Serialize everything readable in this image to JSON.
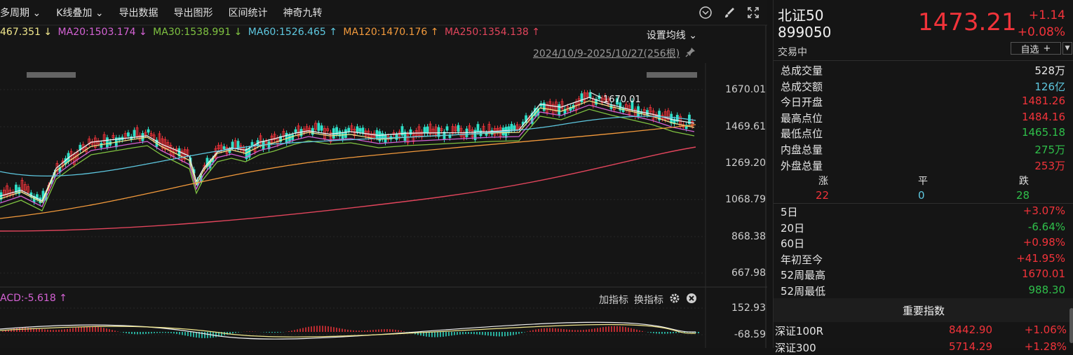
{
  "toolbar": {
    "items": [
      "多周期 ⌄",
      "K线叠加 ⌄",
      "导出数据",
      "导出图形",
      "区间统计",
      "神奇九转"
    ]
  },
  "ma": [
    {
      "text": "467.351 ↓",
      "color": "#f0e68c"
    },
    {
      "text": "MA20:1503.174 ↓",
      "color": "#d462d4"
    },
    {
      "text": "MA30:1538.991 ↓",
      "color": "#7fc241"
    },
    {
      "text": "MA60:1526.465 ↑",
      "color": "#5ec8e0"
    },
    {
      "text": "MA120:1470.176 ↑",
      "color": "#f39a3c"
    },
    {
      "text": "MA250:1354.138 ↑",
      "color": "#e2455c"
    }
  ],
  "ma_setting": "设置均线 ⌄",
  "date_range": "2024/10/9-2025/10/27(256根)",
  "y_axis": [
    "1670.01",
    "1469.61",
    "1269.20",
    "1068.79",
    "868.38",
    "667.98"
  ],
  "max_marker": "1670.01",
  "macd": {
    "label": "ACD:-5.618 ↑",
    "add_indicator": "加指标",
    "swap_indicator": "换指标",
    "y_axis": [
      "152.93",
      "-68.59"
    ]
  },
  "panel": {
    "name": "北证50",
    "code": "899050",
    "status": "交易中",
    "price": "1473.21",
    "change": "+1.14",
    "change_pct": "+0.08%",
    "watch_label": "自选",
    "watch_plus": "+",
    "stats": [
      {
        "label": "总成交量",
        "value": "528万",
        "color": "#e6e6e6"
      },
      {
        "label": "总成交额",
        "value": "126亿",
        "color": "#5ec8e0"
      },
      {
        "label": "今日开盘",
        "value": "1481.26",
        "color": "#f2333a"
      },
      {
        "label": "最高点位",
        "value": "1484.16",
        "color": "#f2333a"
      },
      {
        "label": "最低点位",
        "value": "1465.18",
        "color": "#2fbf4a"
      },
      {
        "label": "内盘总量",
        "value": "275万",
        "color": "#2fbf4a"
      },
      {
        "label": "外盘总量",
        "value": "253万",
        "color": "#f2333a"
      }
    ],
    "updown": {
      "rise_label": "涨",
      "flat_label": "平",
      "fall_label": "跌",
      "rise": "22",
      "flat": "0",
      "fall": "28"
    },
    "periods": [
      {
        "label": "5日",
        "value": "+3.07%",
        "color": "#f2333a"
      },
      {
        "label": "20日",
        "value": "-6.64%",
        "color": "#2fbf4a"
      },
      {
        "label": "60日",
        "value": "+0.98%",
        "color": "#f2333a"
      },
      {
        "label": "年初至今",
        "value": "+41.95%",
        "color": "#f2333a"
      },
      {
        "label": "52周最高",
        "value": "1670.01",
        "color": "#f2333a"
      },
      {
        "label": "52周最低",
        "value": "988.30",
        "color": "#2fbf4a"
      }
    ],
    "important_title": "重要指数",
    "indices": [
      {
        "name": "深证100R",
        "price": "8442.90",
        "pct": "+1.06%"
      },
      {
        "name": "深证300",
        "price": "5714.29",
        "pct": "+1.28%"
      }
    ]
  }
}
